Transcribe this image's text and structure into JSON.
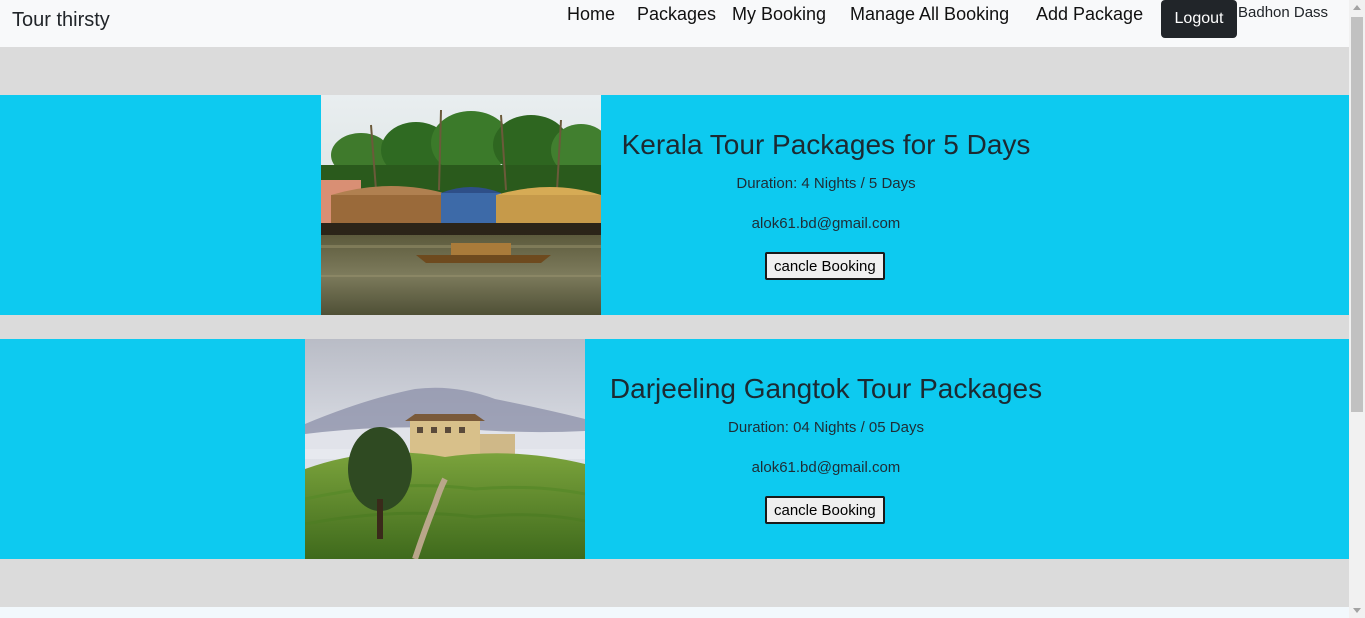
{
  "navbar": {
    "brand": "Tour thirsty",
    "links": [
      "Home",
      "Packages",
      "My Booking",
      "Manage All Booking",
      "Add Package"
    ],
    "logout_label": "Logout",
    "user_name": "Badhon Dass"
  },
  "bookings": [
    {
      "title": "Kerala Tour Packages for 5 Days",
      "duration": "Duration: 4 Nights / 5 Days",
      "email": "alok61.bd@gmail.com",
      "button_label": "cancle Booking",
      "image": "kerala-houseboat-image"
    },
    {
      "title": "Darjeeling Gangtok Tour Packages",
      "duration": "Duration: 04 Nights / 05 Days",
      "email": "alok61.bd@gmail.com",
      "button_label": "cancle Booking",
      "image": "darjeeling-tea-garden-image"
    }
  ],
  "colors": {
    "navbar_bg": "#f8f9fa",
    "page_bg": "#dbdbdb",
    "card_bg": "#0dcaf0",
    "logout_bg": "#212529"
  }
}
